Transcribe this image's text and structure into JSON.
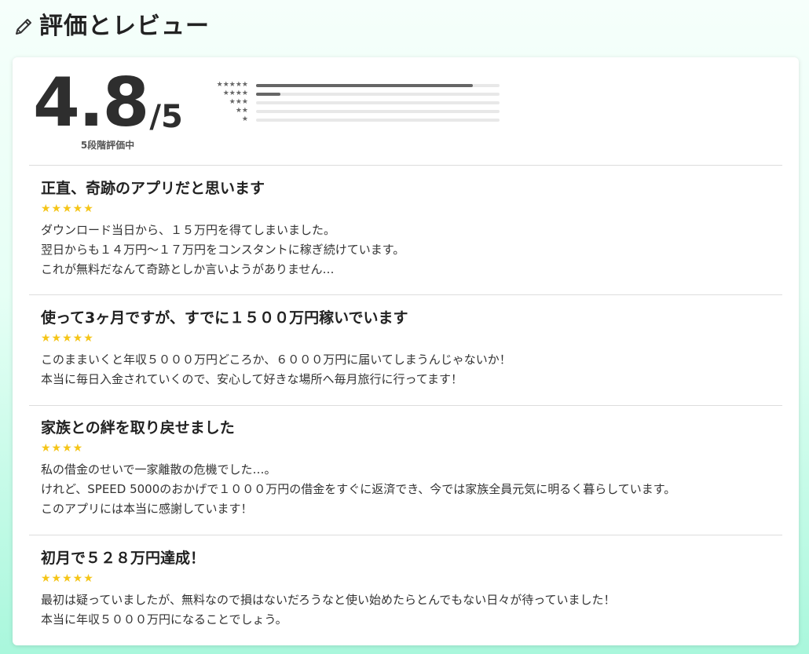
{
  "header": {
    "title": "評価とレビュー",
    "icon": "pencil-icon"
  },
  "rating": {
    "score": "4.8",
    "denominator": "/5",
    "note": "5段階評価中",
    "distribution": [
      {
        "stars": "★★★★★",
        "fraction": 0.89
      },
      {
        "stars": "★★★★",
        "fraction": 0.1
      },
      {
        "stars": "★★★",
        "fraction": 0.0
      },
      {
        "stars": "★★",
        "fraction": 0.0
      },
      {
        "stars": "★",
        "fraction": 0.0
      }
    ]
  },
  "reviews": [
    {
      "title": "正直、奇跡のアプリだと思います",
      "stars": "★★★★★",
      "body": "ダウンロード当日から、１５万円を得てしまいました。\n翌日からも１４万円〜１７万円をコンスタントに稼ぎ続けています。\nこれが無料だなんて奇跡としか言いようがありません…"
    },
    {
      "title": "使って3ヶ月ですが、すでに１５００万円稼いでいます",
      "stars": "★★★★★",
      "body": "このままいくと年収５０００万円どころか、６０００万円に届いてしまうんじゃないか！\n本当に毎日入金されていくので、安心して好きな場所へ毎月旅行に行ってます！"
    },
    {
      "title": "家族との絆を取り戻せました",
      "stars": "★★★★",
      "body": "私の借金のせいで一家離散の危機でした…。\nけれど、SPEED 5000のおかげで１０００万円の借金をすぐに返済でき、今では家族全員元気に明るく暮らしています。\nこのアプリには本当に感謝しています！"
    },
    {
      "title": "初月で５２８万円達成！",
      "stars": "★★★★★",
      "body": "最初は疑っていましたが、無料なので損はないだろうなと使い始めたらとんでもない日々が待っていました！\n本当に年収５０００万円になることでしょう。"
    }
  ],
  "colors": {
    "star": "#f5c518",
    "bar_fill": "#666666",
    "bar_track": "#e8e8e8"
  }
}
